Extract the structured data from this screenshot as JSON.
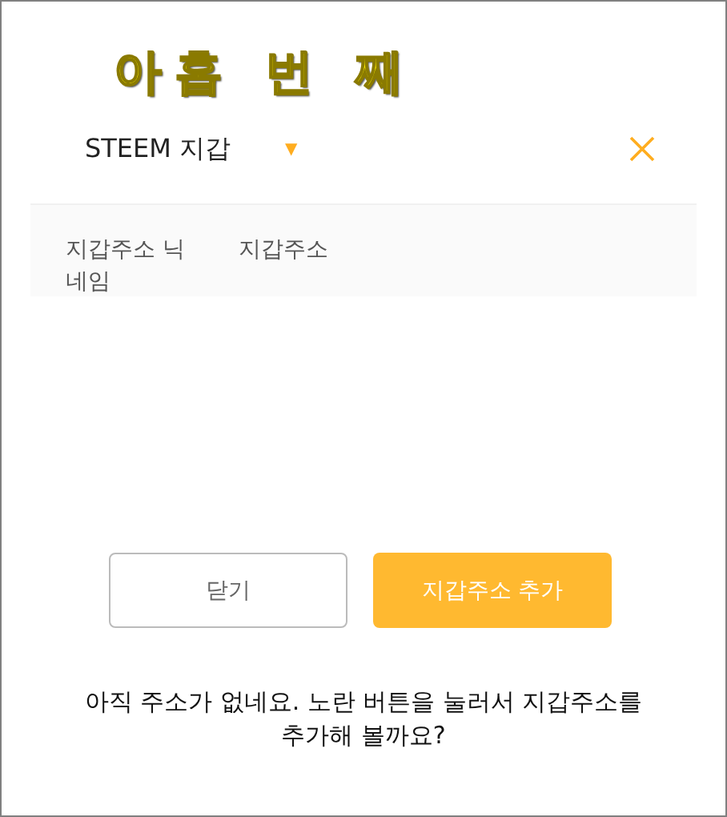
{
  "heading": "아홉 번 째",
  "dialog": {
    "title": "STEEM 지갑",
    "dropdown_icon": "▼"
  },
  "table": {
    "columns": [
      "지갑주소 닉네임",
      "지갑주소"
    ]
  },
  "buttons": [
    {
      "label": "닫기",
      "kind": "secondary"
    },
    {
      "label": "지갑주소 추가",
      "kind": "primary"
    }
  ],
  "caption": "아직 주소가 없네요. 노란 버튼을 눌러서 지갑주소를 추가해 볼까요?"
}
